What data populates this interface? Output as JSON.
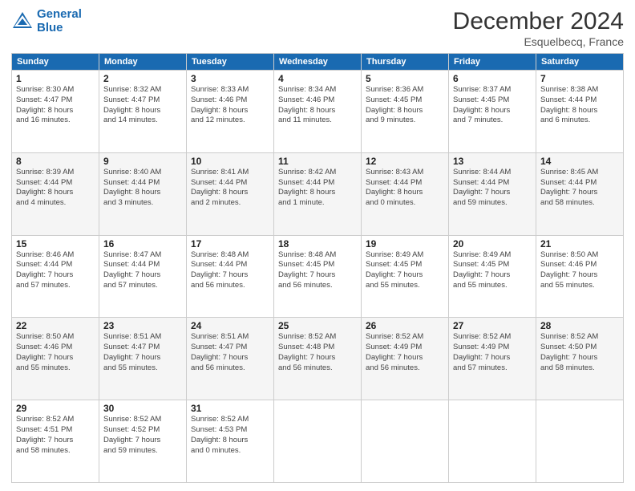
{
  "header": {
    "logo_line1": "General",
    "logo_line2": "Blue",
    "title": "December 2024",
    "subtitle": "Esquelbecq, France"
  },
  "weekdays": [
    "Sunday",
    "Monday",
    "Tuesday",
    "Wednesday",
    "Thursday",
    "Friday",
    "Saturday"
  ],
  "weeks": [
    [
      {
        "day": "1",
        "info": "Sunrise: 8:30 AM\nSunset: 4:47 PM\nDaylight: 8 hours\nand 16 minutes."
      },
      {
        "day": "2",
        "info": "Sunrise: 8:32 AM\nSunset: 4:47 PM\nDaylight: 8 hours\nand 14 minutes."
      },
      {
        "day": "3",
        "info": "Sunrise: 8:33 AM\nSunset: 4:46 PM\nDaylight: 8 hours\nand 12 minutes."
      },
      {
        "day": "4",
        "info": "Sunrise: 8:34 AM\nSunset: 4:46 PM\nDaylight: 8 hours\nand 11 minutes."
      },
      {
        "day": "5",
        "info": "Sunrise: 8:36 AM\nSunset: 4:45 PM\nDaylight: 8 hours\nand 9 minutes."
      },
      {
        "day": "6",
        "info": "Sunrise: 8:37 AM\nSunset: 4:45 PM\nDaylight: 8 hours\nand 7 minutes."
      },
      {
        "day": "7",
        "info": "Sunrise: 8:38 AM\nSunset: 4:44 PM\nDaylight: 8 hours\nand 6 minutes."
      }
    ],
    [
      {
        "day": "8",
        "info": "Sunrise: 8:39 AM\nSunset: 4:44 PM\nDaylight: 8 hours\nand 4 minutes."
      },
      {
        "day": "9",
        "info": "Sunrise: 8:40 AM\nSunset: 4:44 PM\nDaylight: 8 hours\nand 3 minutes."
      },
      {
        "day": "10",
        "info": "Sunrise: 8:41 AM\nSunset: 4:44 PM\nDaylight: 8 hours\nand 2 minutes."
      },
      {
        "day": "11",
        "info": "Sunrise: 8:42 AM\nSunset: 4:44 PM\nDaylight: 8 hours\nand 1 minute."
      },
      {
        "day": "12",
        "info": "Sunrise: 8:43 AM\nSunset: 4:44 PM\nDaylight: 8 hours\nand 0 minutes."
      },
      {
        "day": "13",
        "info": "Sunrise: 8:44 AM\nSunset: 4:44 PM\nDaylight: 7 hours\nand 59 minutes."
      },
      {
        "day": "14",
        "info": "Sunrise: 8:45 AM\nSunset: 4:44 PM\nDaylight: 7 hours\nand 58 minutes."
      }
    ],
    [
      {
        "day": "15",
        "info": "Sunrise: 8:46 AM\nSunset: 4:44 PM\nDaylight: 7 hours\nand 57 minutes."
      },
      {
        "day": "16",
        "info": "Sunrise: 8:47 AM\nSunset: 4:44 PM\nDaylight: 7 hours\nand 57 minutes."
      },
      {
        "day": "17",
        "info": "Sunrise: 8:48 AM\nSunset: 4:44 PM\nDaylight: 7 hours\nand 56 minutes."
      },
      {
        "day": "18",
        "info": "Sunrise: 8:48 AM\nSunset: 4:45 PM\nDaylight: 7 hours\nand 56 minutes."
      },
      {
        "day": "19",
        "info": "Sunrise: 8:49 AM\nSunset: 4:45 PM\nDaylight: 7 hours\nand 55 minutes."
      },
      {
        "day": "20",
        "info": "Sunrise: 8:49 AM\nSunset: 4:45 PM\nDaylight: 7 hours\nand 55 minutes."
      },
      {
        "day": "21",
        "info": "Sunrise: 8:50 AM\nSunset: 4:46 PM\nDaylight: 7 hours\nand 55 minutes."
      }
    ],
    [
      {
        "day": "22",
        "info": "Sunrise: 8:50 AM\nSunset: 4:46 PM\nDaylight: 7 hours\nand 55 minutes."
      },
      {
        "day": "23",
        "info": "Sunrise: 8:51 AM\nSunset: 4:47 PM\nDaylight: 7 hours\nand 55 minutes."
      },
      {
        "day": "24",
        "info": "Sunrise: 8:51 AM\nSunset: 4:47 PM\nDaylight: 7 hours\nand 56 minutes."
      },
      {
        "day": "25",
        "info": "Sunrise: 8:52 AM\nSunset: 4:48 PM\nDaylight: 7 hours\nand 56 minutes."
      },
      {
        "day": "26",
        "info": "Sunrise: 8:52 AM\nSunset: 4:49 PM\nDaylight: 7 hours\nand 56 minutes."
      },
      {
        "day": "27",
        "info": "Sunrise: 8:52 AM\nSunset: 4:49 PM\nDaylight: 7 hours\nand 57 minutes."
      },
      {
        "day": "28",
        "info": "Sunrise: 8:52 AM\nSunset: 4:50 PM\nDaylight: 7 hours\nand 58 minutes."
      }
    ],
    [
      {
        "day": "29",
        "info": "Sunrise: 8:52 AM\nSunset: 4:51 PM\nDaylight: 7 hours\nand 58 minutes."
      },
      {
        "day": "30",
        "info": "Sunrise: 8:52 AM\nSunset: 4:52 PM\nDaylight: 7 hours\nand 59 minutes."
      },
      {
        "day": "31",
        "info": "Sunrise: 8:52 AM\nSunset: 4:53 PM\nDaylight: 8 hours\nand 0 minutes."
      },
      null,
      null,
      null,
      null
    ]
  ]
}
